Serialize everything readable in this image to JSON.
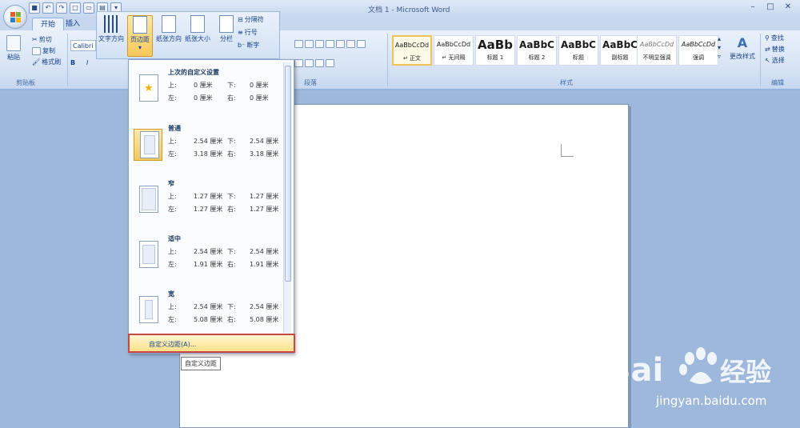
{
  "window": {
    "title": "文档 1 - Microsoft Word"
  },
  "tabs": [
    {
      "label": "开始"
    },
    {
      "label": "插入"
    }
  ],
  "clipboard": {
    "paste": "粘贴",
    "cut": "剪切",
    "copy": "复制",
    "format_painter": "格式刷",
    "group_label": "剪贴板"
  },
  "font": {
    "name": "Calibri"
  },
  "page_setup": {
    "text_direction": "文字方向",
    "margins": "页边距",
    "orientation": "纸张方向",
    "size": "纸张大小",
    "columns": "分栏",
    "breaks": "分隔符",
    "line_numbers": "行号",
    "hyphenation": "断字"
  },
  "paragraph": {
    "group_label": "段落"
  },
  "styles": {
    "group_label": "样式",
    "items": [
      {
        "sample": "AaBbCcDd",
        "name": "↵ 正文"
      },
      {
        "sample": "AaBbCcDd",
        "name": "↵ 无间隔"
      },
      {
        "sample": "AaBb",
        "name": "标题 1"
      },
      {
        "sample": "AaBbC",
        "name": "标题 2"
      },
      {
        "sample": "AaBbC",
        "name": "标题"
      },
      {
        "sample": "AaBbC",
        "name": "副标题"
      },
      {
        "sample": "AaBbCcDd",
        "name": "不明显强调"
      },
      {
        "sample": "AaBbCcDd",
        "name": "强调"
      }
    ],
    "change_styles": "更改样式"
  },
  "editing": {
    "find": "查找",
    "replace": "替换",
    "select": "选择",
    "group_label": "编辑"
  },
  "margins_menu": {
    "items": [
      {
        "title": "上次的自定义设置",
        "top_label": "上:",
        "top": "0 厘米",
        "bottom_label": "下:",
        "bottom": "0 厘米",
        "left_label": "左:",
        "left": "0 厘米",
        "right_label": "右:",
        "right": "0 厘米"
      },
      {
        "title": "普通",
        "top_label": "上:",
        "top": "2.54 厘米",
        "bottom_label": "下:",
        "bottom": "2.54 厘米",
        "left_label": "左:",
        "left": "3.18 厘米",
        "right_label": "右:",
        "right": "3.18 厘米"
      },
      {
        "title": "窄",
        "top_label": "上:",
        "top": "1.27 厘米",
        "bottom_label": "下:",
        "bottom": "1.27 厘米",
        "left_label": "左:",
        "left": "1.27 厘米",
        "right_label": "右:",
        "right": "1.27 厘米"
      },
      {
        "title": "适中",
        "top_label": "上:",
        "top": "2.54 厘米",
        "bottom_label": "下:",
        "bottom": "2.54 厘米",
        "left_label": "左:",
        "left": "1.91 厘米",
        "right_label": "右:",
        "right": "1.91 厘米"
      },
      {
        "title": "宽",
        "top_label": "上:",
        "top": "2.54 厘米",
        "bottom_label": "下:",
        "bottom": "2.54 厘米",
        "left_label": "左:",
        "left": "5.08 厘米",
        "right_label": "右:",
        "right": "5.08 厘米"
      }
    ],
    "custom_label": "自定义边距(A)...",
    "tooltip": "自定义边距"
  },
  "watermark": {
    "brand": "Bai",
    "brand2": "经验",
    "url": "jingyan.baidu.com"
  },
  "colors": {
    "accent": "#f7c85a",
    "highlight_border": "#cc4444"
  }
}
